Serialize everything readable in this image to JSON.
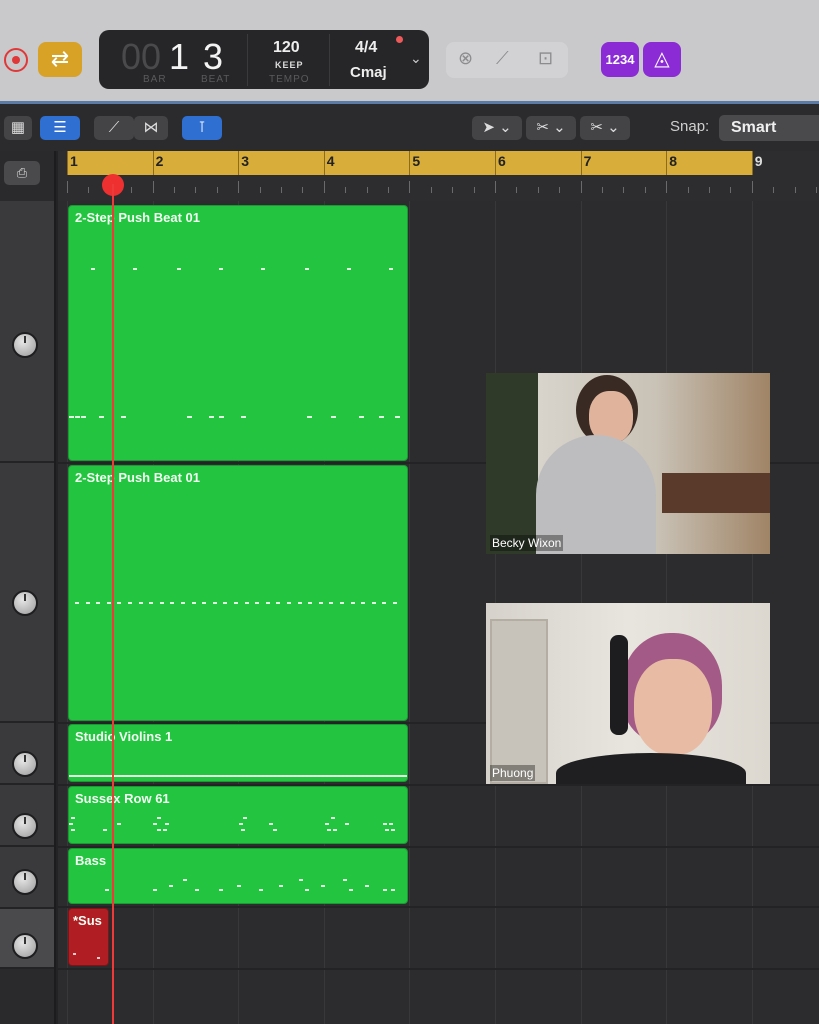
{
  "control_bar": {
    "lcd": {
      "bar_dim": "00",
      "bar": "1",
      "beat": "3",
      "bar_label": "BAR",
      "beat_label": "BEAT",
      "tempo": "120",
      "tempo_sub": "KEEP",
      "tempo_label": "TEMPO",
      "signature": "4/4",
      "key": "Cmaj"
    },
    "count_in_label": "1234",
    "colors": {
      "cycle": "#d8a227",
      "purple": "#8a2bd6",
      "record": "#e03838"
    }
  },
  "toolbar": {
    "snap_label": "Snap:",
    "snap_value": "Smart"
  },
  "ruler": {
    "bars": [
      "1",
      "2",
      "3",
      "4",
      "5",
      "6",
      "7",
      "8",
      "9"
    ]
  },
  "regions": [
    {
      "name": "2-Step Push Beat 01"
    },
    {
      "name": "2-Step Push Beat 01"
    },
    {
      "name": "Studio Violins 1"
    },
    {
      "name": "Sussex Row 61"
    },
    {
      "name": "Bass"
    },
    {
      "name": "*Sus"
    }
  ],
  "video_tiles": [
    {
      "name": "Becky Wixon"
    },
    {
      "name": "Phuong"
    }
  ]
}
